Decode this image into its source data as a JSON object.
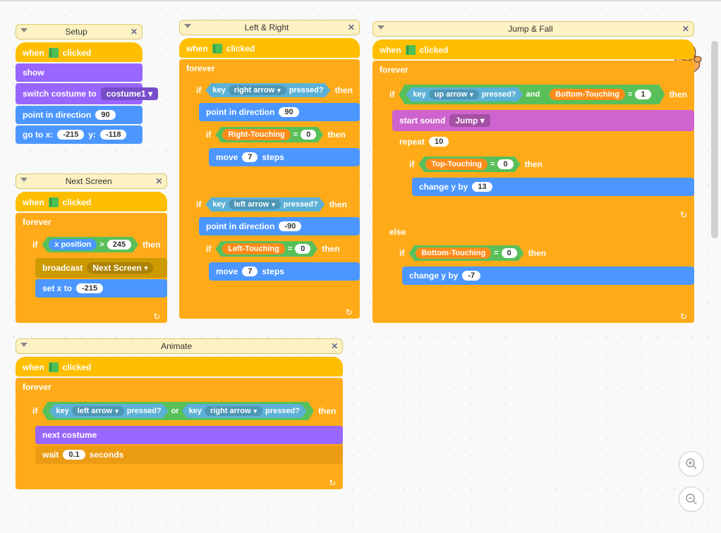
{
  "scripts": {
    "setup": {
      "title": "Setup",
      "when_clicked": "clicked",
      "when": "when",
      "show": "show",
      "switch_costume_to": "switch costume to",
      "costume": "costume1",
      "point_in_direction": "point in direction",
      "direction": "90",
      "go_to": "go to x:",
      "y_label": "y:",
      "x": "-215",
      "y": "-118"
    },
    "next_screen": {
      "title": "Next Screen",
      "when": "when",
      "when_clicked": "clicked",
      "forever": "forever",
      "if": "if",
      "then": "then",
      "x_position": "x position",
      "gt": ">",
      "threshold": "245",
      "broadcast": "broadcast",
      "broadcast_msg": "Next Screen",
      "set_x_to": "set x to",
      "reset_x": "-215"
    },
    "left_right": {
      "title": "Left & Right",
      "when": "when",
      "when_clicked": "clicked",
      "forever": "forever",
      "if": "if",
      "then": "then",
      "key": "key",
      "right_arrow": "right arrow",
      "left_arrow": "left arrow",
      "pressed": "pressed?",
      "point_in_direction": "point in direction",
      "dir_right": "90",
      "dir_left": "-90",
      "right_touching": "Right-Touching",
      "left_touching": "Left-Touching",
      "eq": "=",
      "zero": "0",
      "move": "move",
      "steps": "steps",
      "step_val": "7"
    },
    "jump_fall": {
      "title": "Jump & Fall",
      "when": "when",
      "when_clicked": "clicked",
      "forever": "forever",
      "if": "if",
      "then": "then",
      "else": "else",
      "key": "key",
      "up_arrow": "up arrow",
      "pressed": "pressed?",
      "and": "and",
      "bottom_touching": "Bottom-Touching",
      "top_touching": "Top-Touching",
      "eq": "=",
      "one": "1",
      "zero": "0",
      "start_sound": "start sound",
      "sound": "Jump",
      "repeat": "repeat",
      "repeat_n": "10",
      "change_y_by": "change y by",
      "up_val": "13",
      "down_val": "-7"
    },
    "animate": {
      "title": "Animate",
      "when": "when",
      "when_clicked": "clicked",
      "forever": "forever",
      "if": "if",
      "then": "then",
      "key": "key",
      "left_arrow": "left arrow",
      "right_arrow": "right arrow",
      "pressed": "pressed?",
      "or": "or",
      "next_costume": "next costume",
      "wait": "wait",
      "wait_val": "0.1",
      "seconds": "seconds"
    }
  },
  "icons": {
    "close": "✕",
    "caret": "▾",
    "loop": "↻"
  },
  "zoom": {
    "in": "+",
    "out": "−"
  }
}
